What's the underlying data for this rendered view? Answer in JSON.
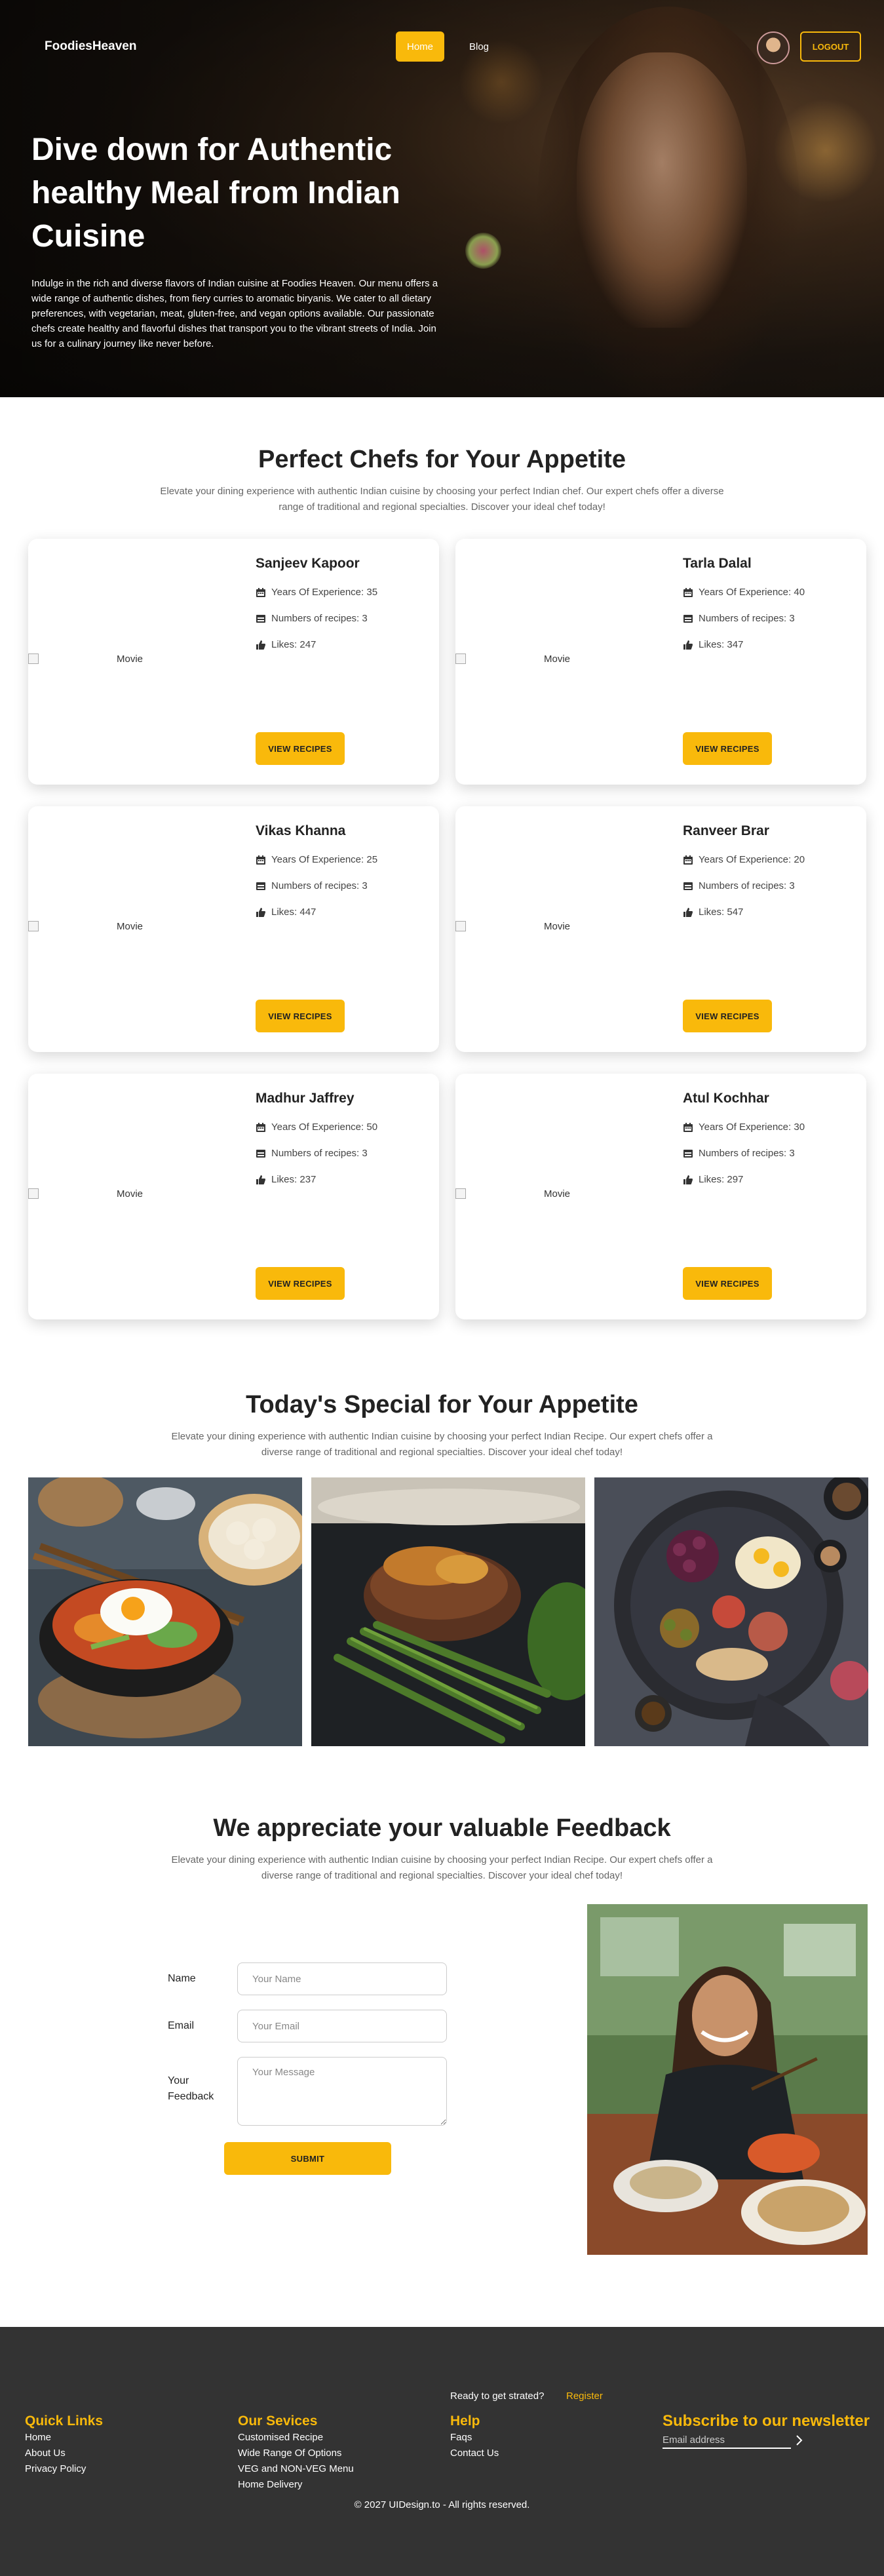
{
  "nav": {
    "logo": "FoodiesHeaven",
    "home": "Home",
    "blog": "Blog",
    "logout": "LOGOUT"
  },
  "hero": {
    "title": "Dive down for Authentic healthy Meal from Indian Cuisine",
    "text": "Indulge in the rich and diverse flavors of Indian cuisine at Foodies Heaven. Our menu offers a wide range of authentic dishes, from fiery curries to aromatic biryanis. We cater to all dietary preferences, with vegetarian, meat, gluten-free, and vegan options available. Our passionate chefs create healthy and flavorful dishes that transport you to the vibrant streets of India. Join us for a culinary journey like never before."
  },
  "chefs_section": {
    "title": "Perfect Chefs for Your Appetite",
    "subtitle": "Elevate your dining experience with authentic Indian cuisine by choosing your perfect Indian chef. Our expert chefs offer a diverse range of traditional and regional specialties. Discover your ideal chef today!",
    "image_alt": "Movie",
    "button_label": "VIEW RECIPES",
    "chefs": [
      {
        "name": "Sanjeev Kapoor",
        "experience": "Years Of Experience: 35",
        "recipes": "Numbers of recipes: 3",
        "likes": "Likes: 247"
      },
      {
        "name": "Tarla Dalal",
        "experience": "Years Of Experience: 40",
        "recipes": "Numbers of recipes: 3",
        "likes": "Likes: 347"
      },
      {
        "name": "Vikas Khanna",
        "experience": "Years Of Experience: 25",
        "recipes": "Numbers of recipes: 3",
        "likes": "Likes: 447"
      },
      {
        "name": "Ranveer Brar",
        "experience": "Years Of Experience: 20",
        "recipes": "Numbers of recipes: 3",
        "likes": "Likes: 547"
      },
      {
        "name": "Madhur Jaffrey",
        "experience": "Years Of Experience: 50",
        "recipes": "Numbers of recipes: 3",
        "likes": "Likes: 237"
      },
      {
        "name": "Atul Kochhar",
        "experience": "Years Of Experience: 30",
        "recipes": "Numbers of recipes: 3",
        "likes": "Likes: 297"
      }
    ]
  },
  "special_section": {
    "title": "Today's Special for Your Appetite",
    "subtitle": "Elevate your dining experience with authentic Indian cuisine by choosing your perfect Indian Recipe. Our expert chefs offer a diverse range of traditional and regional specialties. Discover your ideal chef today!"
  },
  "feedback_section": {
    "title": "We appreciate your valuable Feedback",
    "subtitle": "Elevate your dining experience with authentic Indian cuisine by choosing your perfect Indian Recipe. Our expert chefs offer a diverse range of traditional and regional specialties. Discover your ideal chef today!",
    "name_label": "Name",
    "name_placeholder": "Your Name",
    "email_label": "Email",
    "email_placeholder": "Your Email",
    "feedback_label": "Your Feedback",
    "message_placeholder": "Your Message",
    "submit_label": "SUBMIT"
  },
  "footer": {
    "ready_text": "Ready to get strated?",
    "register": "Register",
    "quick_links": {
      "title": "Quick Links",
      "items": [
        "Home",
        "About Us",
        "Privacy Policy"
      ]
    },
    "services": {
      "title": "Our Sevices",
      "items": [
        "Customised Recipe",
        "Wide Range Of Options",
        "VEG and NON-VEG Menu",
        "Home Delivery"
      ]
    },
    "help": {
      "title": "Help",
      "items": [
        "Faqs",
        "Contact Us"
      ]
    },
    "newsletter": {
      "title": "Subscribe to our newsletter",
      "email_placeholder": "Email address"
    },
    "copyright": "© 2027 UIDesign.to - All rights reserved."
  },
  "colors": {
    "accent": "#f9b90b",
    "footer_bg": "#333333",
    "text_dark": "#222222"
  }
}
